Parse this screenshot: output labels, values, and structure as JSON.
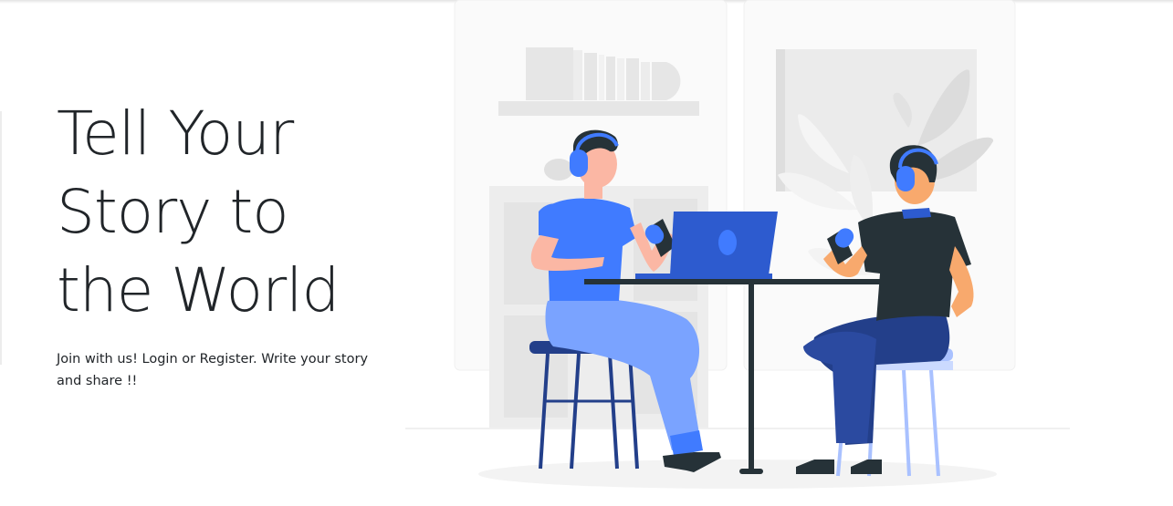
{
  "hero": {
    "title_lines": [
      "Tell Your",
      "Story to",
      "the World"
    ],
    "subtitle": "Join with us! Login or Register. Write your story and share !!"
  },
  "illustration": {
    "icon": "podcast-illustration",
    "colors": {
      "accent": "#407bff",
      "accent_dark": "#2d5bcf",
      "navy": "#233f8a",
      "light_blue": "#7aa3ff",
      "pale_blue": "#a9c1ff",
      "skin": "#fbb7a4",
      "skin_tan": "#f8a96d",
      "hair": "#263238",
      "background_gray": "#ebebeb"
    }
  }
}
